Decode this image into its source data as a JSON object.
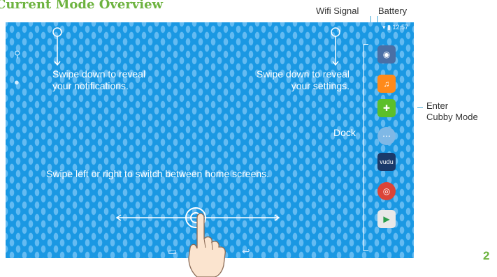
{
  "header": {
    "title": "Current Mode Overview"
  },
  "callouts": {
    "wifi_label": "Wifi Signal",
    "battery_label": "Battery",
    "cubby_label_line1": "Enter",
    "cubby_label_line2": "Cubby Mode"
  },
  "screen": {
    "status_time": "12:57",
    "hints": {
      "notifications_line1": "Swipe down to reveal",
      "notifications_line2": "your notifications.",
      "settings_line1": "Swipe down to reveal",
      "settings_line2": "your settings.",
      "swipe": "Swipe left or right to switch between home screens."
    },
    "dock": {
      "label": "Dock",
      "apps": [
        {
          "name": "camera-app-icon",
          "color": "#4a6fa5"
        },
        {
          "name": "headphones-app-icon",
          "color": "#ff8a1a"
        },
        {
          "name": "puzzle-app-icon",
          "color": "#5cbf2a"
        },
        {
          "name": "app-drawer-icon",
          "color": "#7fb8e6"
        },
        {
          "name": "vudu-app-icon",
          "color": "#1a3a6a",
          "text": "vudu"
        },
        {
          "name": "chrome-app-icon",
          "color": "#db4437"
        },
        {
          "name": "play-store-icon",
          "color": "#e8e8e8"
        }
      ]
    }
  },
  "footer": {
    "page_number": "2"
  }
}
